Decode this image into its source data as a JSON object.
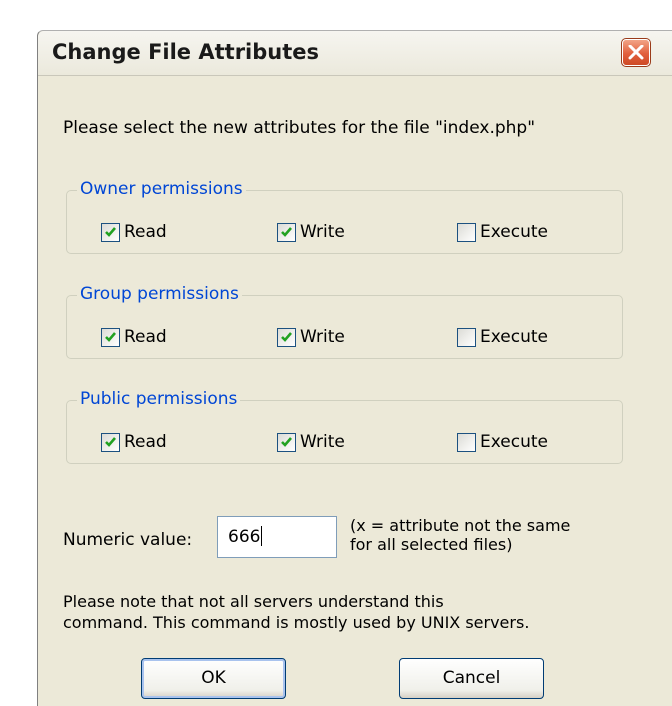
{
  "window": {
    "title": "Change File Attributes"
  },
  "prompt": "Please select the new attributes for the file \"index.php\"",
  "groups": [
    {
      "legend": "Owner permissions",
      "checks": [
        {
          "label": "Read",
          "checked": true
        },
        {
          "label": "Write",
          "checked": true
        },
        {
          "label": "Execute",
          "checked": false
        }
      ]
    },
    {
      "legend": "Group permissions",
      "checks": [
        {
          "label": "Read",
          "checked": true
        },
        {
          "label": "Write",
          "checked": true
        },
        {
          "label": "Execute",
          "checked": false
        }
      ]
    },
    {
      "legend": "Public permissions",
      "checks": [
        {
          "label": "Read",
          "checked": true
        },
        {
          "label": "Write",
          "checked": true
        },
        {
          "label": "Execute",
          "checked": false
        }
      ]
    }
  ],
  "numeric": {
    "label": "Numeric value:",
    "value": "666",
    "hint_line1": "(x = attribute not the same",
    "hint_line2": "for all selected files)"
  },
  "note": {
    "line1": "Please note that not all servers understand this",
    "line2": "command. This command is mostly used by UNIX servers."
  },
  "buttons": {
    "ok": "OK",
    "cancel": "Cancel"
  },
  "colors": {
    "dialog_bg": "#ece9d8",
    "legend_text": "#0046d5",
    "close_button": "#e2603d",
    "checkmark": "#21a121"
  }
}
